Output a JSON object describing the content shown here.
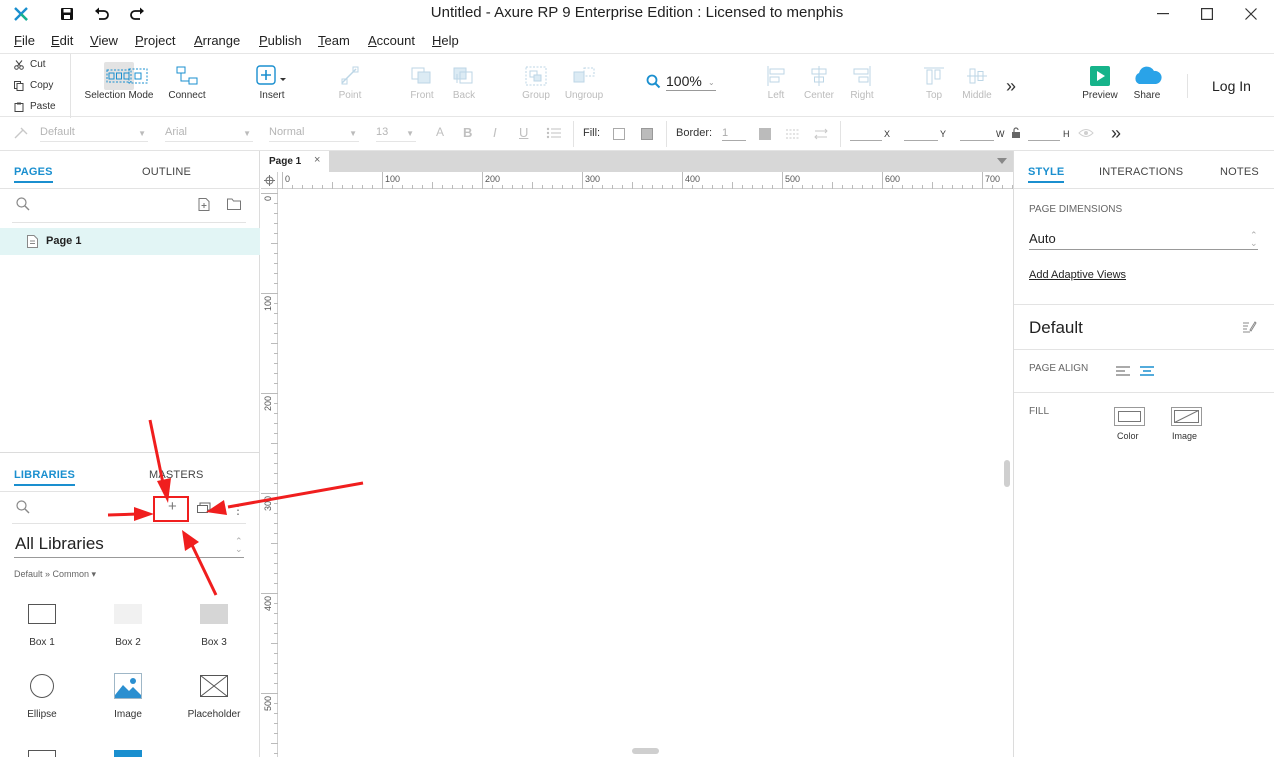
{
  "app": {
    "title": "Untitled - Axure RP 9 Enterprise Edition : Licensed to menphis",
    "accent": "#1a8fcf"
  },
  "menu": [
    "File",
    "Edit",
    "View",
    "Project",
    "Arrange",
    "Publish",
    "Team",
    "Account",
    "Help"
  ],
  "clipboard": {
    "cut": "Cut",
    "copy": "Copy",
    "paste": "Paste"
  },
  "toolbar": {
    "selection_mode": "Selection Mode",
    "connect": "Connect",
    "insert": "Insert",
    "point": "Point",
    "front": "Front",
    "back": "Back",
    "group": "Group",
    "ungroup": "Ungroup",
    "zoom": "100%",
    "left": "Left",
    "center": "Center",
    "right": "Right",
    "top": "Top",
    "middle": "Middle",
    "preview": "Preview",
    "share": "Share",
    "login": "Log In"
  },
  "format": {
    "style": "Default",
    "font": "Arial",
    "weight": "Normal",
    "size": "13",
    "fill_label": "Fill:",
    "border_label": "Border:",
    "border_value": "1",
    "x_label": "X",
    "y_label": "Y",
    "w_label": "W",
    "h_label": "H"
  },
  "left": {
    "tab_pages": "PAGES",
    "tab_outline": "OUTLINE",
    "page_item": "Page 1",
    "tab_libraries": "LIBRARIES",
    "tab_masters": "MASTERS",
    "library_select": "All Libraries",
    "library_path": "Default » Common ▾",
    "widgets": [
      "Box 1",
      "Box 2",
      "Box 3",
      "Ellipse",
      "Image",
      "Placeholder"
    ]
  },
  "canvas": {
    "page_tab": "Page 1",
    "hticks": [
      "0",
      "100",
      "200",
      "300",
      "400",
      "500",
      "600",
      "700"
    ],
    "vticks": [
      "0",
      "100",
      "200",
      "300",
      "400",
      "500"
    ]
  },
  "right": {
    "tab_style": "STYLE",
    "tab_interactions": "INTERACTIONS",
    "tab_notes": "NOTES",
    "page_dimensions_label": "PAGE DIMENSIONS",
    "page_dimensions_value": "Auto",
    "adaptive_link": "Add Adaptive Views",
    "style_name": "Default",
    "page_align_label": "PAGE ALIGN",
    "fill_label": "FILL",
    "fill_color": "Color",
    "fill_image": "Image"
  }
}
